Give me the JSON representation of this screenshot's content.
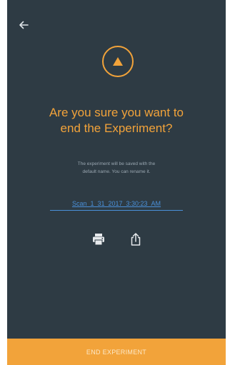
{
  "dialog": {
    "back_icon": "arrow-left-icon",
    "warning_icon": "warning-triangle-icon",
    "title_line1": "Are you sure you want to",
    "title_line2": "end the Experiment?",
    "description_line1": "The experiment will be saved with the",
    "description_line2": "default name. You can rename it.",
    "experiment_name": "Scan_1_31_2017_3:30:23_AM",
    "print_icon": "print-icon",
    "share_icon": "share-icon",
    "end_button_label": "END EXPERIMENT"
  },
  "colors": {
    "background": "#2e3b44",
    "accent": "#f2a33a",
    "link": "#4a90d9",
    "icon": "#e6e9ec"
  }
}
